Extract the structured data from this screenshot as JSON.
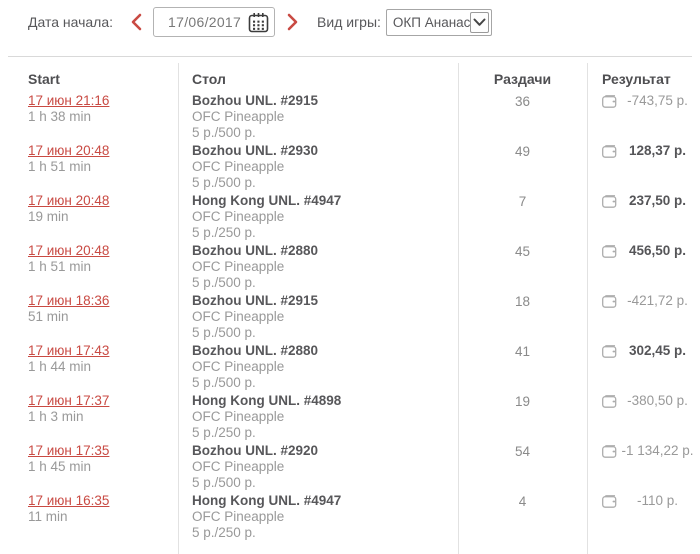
{
  "topbar": {
    "date_label": "Дата начала:",
    "date_value": "17/06/2017",
    "game_label": "Вид игры:",
    "game_value": "ОКП Ананас"
  },
  "table": {
    "headers": {
      "start": "Start",
      "table": "Стол",
      "hands": "Раздачи",
      "result": "Результат"
    },
    "rows": [
      {
        "start": "17 июн 21:16",
        "duration": "1 h 38 min",
        "table_name": "Bozhou UNL. #2915",
        "game": "OFC Pineapple",
        "stakes": "5 р./500 р.",
        "hands": "36",
        "result": "-743,75 р.",
        "positive": false
      },
      {
        "start": "17 июн 20:48",
        "duration": "1 h 51 min",
        "table_name": "Bozhou UNL. #2930",
        "game": "OFC Pineapple",
        "stakes": "5 р./500 р.",
        "hands": "49",
        "result": "128,37 р.",
        "positive": true
      },
      {
        "start": "17 июн 20:48",
        "duration": "19 min",
        "table_name": "Hong Kong UNL. #4947",
        "game": "OFC Pineapple",
        "stakes": "5 р./250 р.",
        "hands": "7",
        "result": "237,50 р.",
        "positive": true
      },
      {
        "start": "17 июн 20:48",
        "duration": "1 h 51 min",
        "table_name": "Bozhou UNL. #2880",
        "game": "OFC Pineapple",
        "stakes": "5 р./500 р.",
        "hands": "45",
        "result": "456,50 р.",
        "positive": true
      },
      {
        "start": "17 июн 18:36",
        "duration": "51 min",
        "table_name": "Bozhou UNL. #2915",
        "game": "OFC Pineapple",
        "stakes": "5 р./500 р.",
        "hands": "18",
        "result": "-421,72 р.",
        "positive": false
      },
      {
        "start": "17 июн 17:43",
        "duration": "1 h 44 min",
        "table_name": "Bozhou UNL. #2880",
        "game": "OFC Pineapple",
        "stakes": "5 р./500 р.",
        "hands": "41",
        "result": "302,45 р.",
        "positive": true
      },
      {
        "start": "17 июн 17:37",
        "duration": "1 h 3 min",
        "table_name": "Hong Kong UNL. #4898",
        "game": "OFC Pineapple",
        "stakes": "5 р./250 р.",
        "hands": "19",
        "result": "-380,50 р.",
        "positive": false
      },
      {
        "start": "17 июн 17:35",
        "duration": "1 h 45 min",
        "table_name": "Bozhou UNL. #2920",
        "game": "OFC Pineapple",
        "stakes": "5 р./500 р.",
        "hands": "54",
        "result": "-1 134,22 р.",
        "positive": false
      },
      {
        "start": "17 июн 16:35",
        "duration": "11 min",
        "table_name": "Hong Kong UNL. #4947",
        "game": "OFC Pineapple",
        "stakes": "5 р./250 р.",
        "hands": "4",
        "result": "-110 р.",
        "positive": false
      }
    ]
  },
  "icons": {
    "prev": "chevron-left",
    "next": "chevron-right",
    "calendar": "calendar",
    "dropdown": "chevron-down",
    "wallet": "wallet"
  },
  "colors": {
    "accent_red": "#c94a43",
    "positive_text": "#555558",
    "negative_text": "#999999",
    "divider": "#e2e2e2"
  }
}
